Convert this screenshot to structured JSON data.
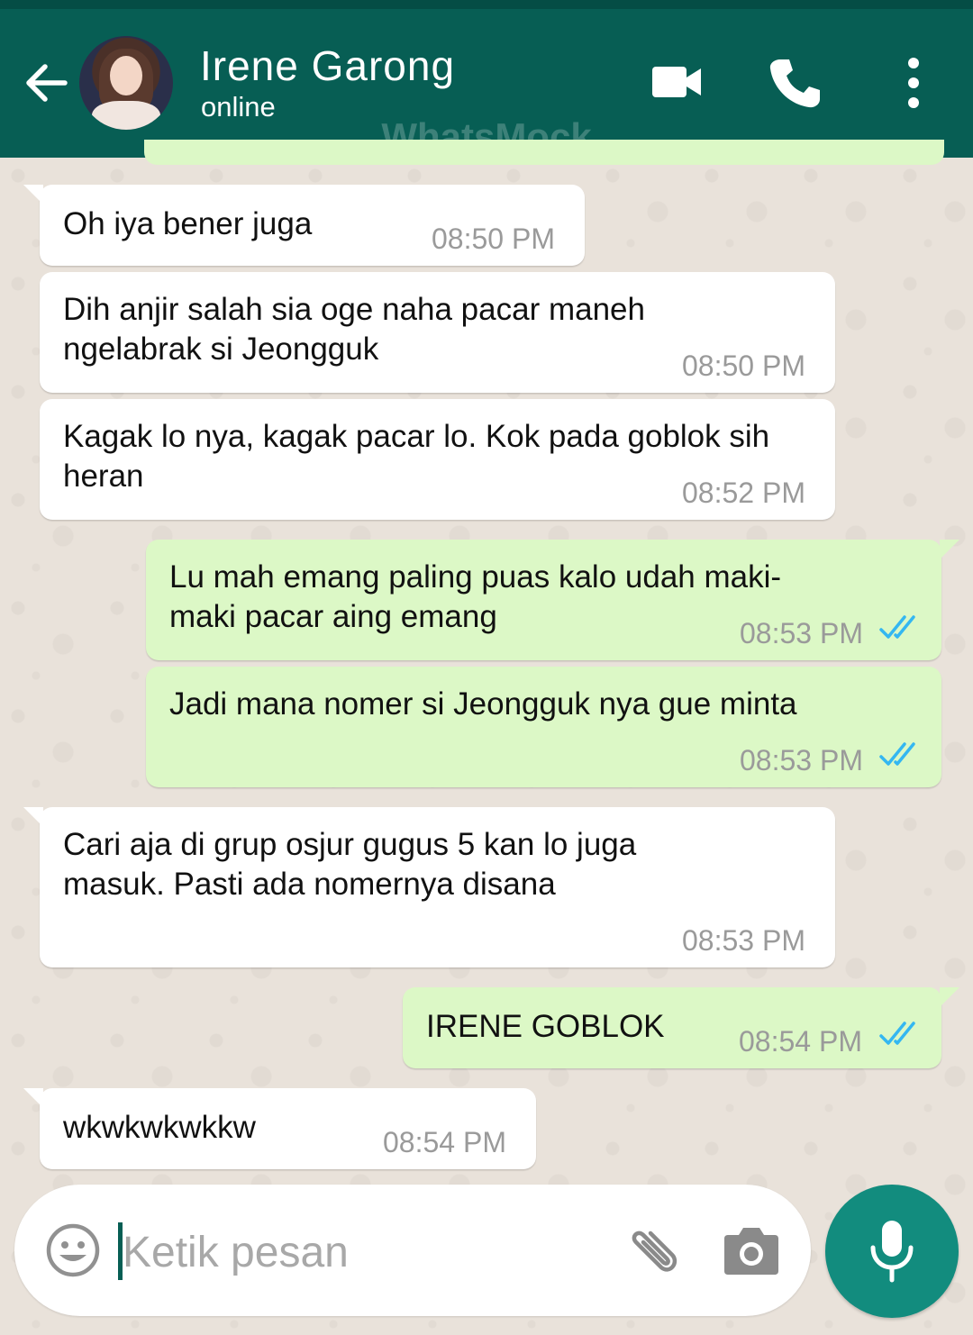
{
  "header": {
    "contact_name": "Irene Garong",
    "status": "online",
    "watermark": "WhatsMock",
    "accent_color": "#075e54"
  },
  "messages": [
    {
      "direction": "in",
      "text": "Oh iya bener juga",
      "time": "08:50 PM"
    },
    {
      "direction": "in",
      "text": "Dih anjir salah sia oge naha pacar maneh ngelabrak si Jeongguk",
      "time": "08:50 PM"
    },
    {
      "direction": "in",
      "text": "Kagak lo nya, kagak pacar lo. Kok pada goblok sih heran",
      "time": "08:52 PM"
    },
    {
      "direction": "out",
      "text": "Lu mah emang paling puas kalo udah maki-maki pacar aing emang",
      "time": "08:53 PM",
      "status": "read"
    },
    {
      "direction": "out",
      "text": "Jadi mana nomer si Jeongguk nya gue minta",
      "time": "08:53 PM",
      "status": "read"
    },
    {
      "direction": "in",
      "text": "Cari aja di grup osjur gugus 5 kan lo juga masuk. Pasti ada nomernya disana",
      "time": "08:53 PM"
    },
    {
      "direction": "out",
      "text": "IRENE GOBLOK",
      "time": "08:54 PM",
      "status": "read"
    },
    {
      "direction": "in",
      "text": "wkwkwkwkkw",
      "time": "08:54 PM"
    }
  ],
  "composer": {
    "placeholder": "Ketik pesan"
  },
  "icons": {
    "back": "arrow-left-icon",
    "video": "video-camera-icon",
    "call": "phone-icon",
    "more": "more-vertical-icon",
    "emoji": "emoji-icon",
    "attach": "paperclip-icon",
    "camera": "camera-icon",
    "mic": "microphone-icon",
    "read_receipt": "double-check-icon",
    "read_color": "#34b7f1"
  }
}
